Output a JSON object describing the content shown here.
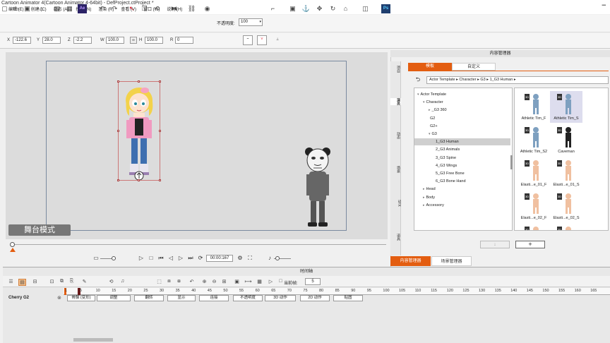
{
  "app": {
    "title": "Cartoon Animator 4(Cartoon Animator 4-64bit) - DefProject.ctProject *",
    "minimize_icon": "minimize"
  },
  "menu": [
    "编辑 (E)",
    "创建 (C)",
    "动态 (A)",
    "控制 (N)",
    "渲染 (R)",
    "查看 (V)",
    "窗口 (W)",
    "说明 (H)"
  ],
  "toolbar": {
    "opacity_label": "不透明度:",
    "opacity_value": "100",
    "ps_label": "Ps",
    "ae_label": "Ae"
  },
  "transform": {
    "x_label": "X",
    "x_value": "-122.6",
    "y_label": "Y",
    "y_value": "28.0",
    "z_label": "Z",
    "z_value": "-2.2",
    "w_label": "W",
    "w_value": "100.0",
    "h_label": "H",
    "h_value": "100.0",
    "r_label": "R",
    "r_value": "0"
  },
  "stage": {
    "mode_label": "舞台模式",
    "time_value": "00:00:167"
  },
  "content_manager": {
    "title": "内容管理器",
    "tab_template": "模板",
    "tab_custom": "自定义",
    "path": [
      "Actor Template",
      "Character",
      "G3",
      "1_G3 Human"
    ],
    "vtabs": [
      "项目",
      "演员",
      "动态",
      "场景",
      "SFX",
      "道具"
    ],
    "tree": [
      {
        "label": "Actor Template",
        "level": 0,
        "arrow": "▾"
      },
      {
        "label": "Character",
        "level": 1,
        "arrow": "▾"
      },
      {
        "label": "_G3 360",
        "level": 2,
        "arrow": "▸"
      },
      {
        "label": "G2",
        "level": 2,
        "arrow": ""
      },
      {
        "label": "G2+",
        "level": 2,
        "arrow": ""
      },
      {
        "label": "G3",
        "level": 2,
        "arrow": "▾"
      },
      {
        "label": "1_G3 Human",
        "level": 3,
        "arrow": "",
        "selected": true
      },
      {
        "label": "2_G3 Animals",
        "level": 3,
        "arrow": ""
      },
      {
        "label": "3_G3 Spine",
        "level": 3,
        "arrow": ""
      },
      {
        "label": "4_G3 Wings",
        "level": 3,
        "arrow": ""
      },
      {
        "label": "5_G3 Free Bone",
        "level": 3,
        "arrow": ""
      },
      {
        "label": "6_G3 Bone Hand",
        "level": 3,
        "arrow": ""
      },
      {
        "label": "Head",
        "level": 1,
        "arrow": "▸"
      },
      {
        "label": "Body",
        "level": 1,
        "arrow": "▸"
      },
      {
        "label": "Accessory",
        "level": 1,
        "arrow": "▸"
      }
    ],
    "items": [
      {
        "label": "Athletic Tim_F",
        "badge": "3D"
      },
      {
        "label": "Athletic Tim_S",
        "badge": "3D"
      },
      {
        "label": "Athletic Tim_S2",
        "badge": "3D"
      },
      {
        "label": "Caveman",
        "badge": "3D"
      },
      {
        "label": "Elasti...e_01_F",
        "badge": "3D"
      },
      {
        "label": "Elasti...e_01_S",
        "badge": "3D"
      },
      {
        "label": "Elasti...e_02_F",
        "badge": "3D"
      },
      {
        "label": "Elasti...e_02_S",
        "badge": "3D"
      },
      {
        "label": "",
        "badge": "3D"
      },
      {
        "label": "",
        "badge": "3D"
      }
    ],
    "add_label": "+",
    "down_label": "↓",
    "bottom_tab_content": "内容管理器",
    "bottom_tab_scene": "场景管理器"
  },
  "timeline": {
    "title": "时间轴",
    "current_frame_label": "当前帧:",
    "current_frame_value": "5",
    "ruler": [
      "1",
      "5",
      "10",
      "15",
      "20",
      "25",
      "30",
      "35",
      "40",
      "45",
      "50",
      "55",
      "60",
      "65",
      "70",
      "75",
      "80",
      "85",
      "90",
      "95",
      "100",
      "105",
      "110",
      "115",
      "120",
      "125",
      "130",
      "135",
      "140",
      "145",
      "150",
      "155",
      "160",
      "165"
    ],
    "track_name": "Cherry G2",
    "chips": [
      "骨骼 (变形)",
      "调整",
      "翻转",
      "显示",
      "连接",
      "不透明度",
      "3D 动作",
      "2D 动作",
      "贴图"
    ]
  }
}
